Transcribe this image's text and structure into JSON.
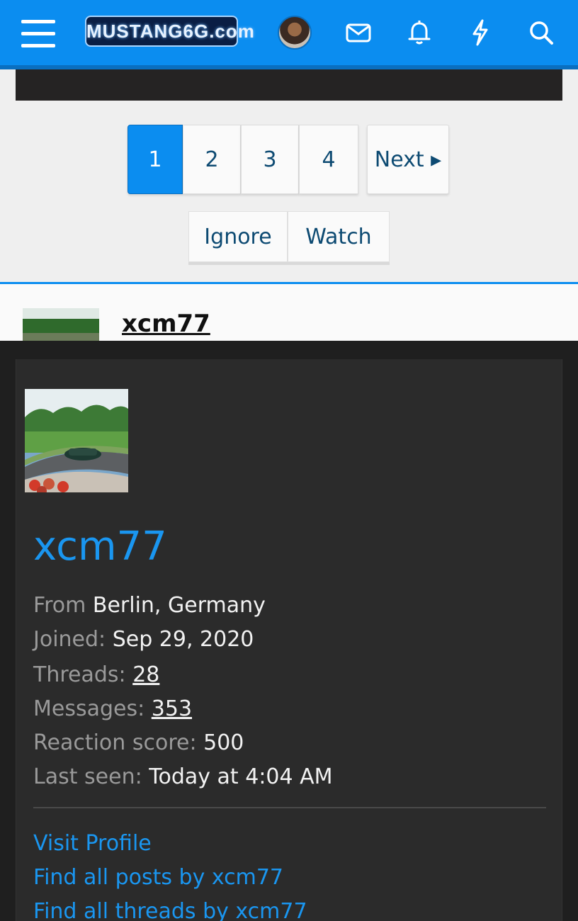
{
  "header": {
    "logo_text": "MUSTANG6G.com",
    "menu_icon": "hamburger-menu-icon",
    "icons": [
      "envelope-icon",
      "bell-icon",
      "lightning-icon",
      "search-icon"
    ],
    "brand_color": "#0b8df0"
  },
  "pagination": {
    "pages": [
      "1",
      "2",
      "3",
      "4"
    ],
    "active_page": "1",
    "next_label": "Next ▸"
  },
  "thread_actions": {
    "ignore_label": "Ignore",
    "watch_label": "Watch"
  },
  "post": {
    "username": "xcm77"
  },
  "member_card": {
    "username": "xcm77",
    "from_label": "From",
    "from_value": "Berlin, Germany",
    "joined_label": "Joined:",
    "joined_value": "Sep 29, 2020",
    "threads_label": "Threads:",
    "threads_value": "28",
    "messages_label": "Messages:",
    "messages_value": "353",
    "reaction_label": "Reaction score:",
    "reaction_value": "500",
    "last_seen_label": "Last seen:",
    "last_seen_value": "Today at 4:04 AM",
    "links": {
      "visit_profile": "Visit Profile",
      "find_posts": "Find all posts by xcm77",
      "find_threads": "Find all threads by xcm77"
    },
    "accent_color": "#1a96f0"
  }
}
